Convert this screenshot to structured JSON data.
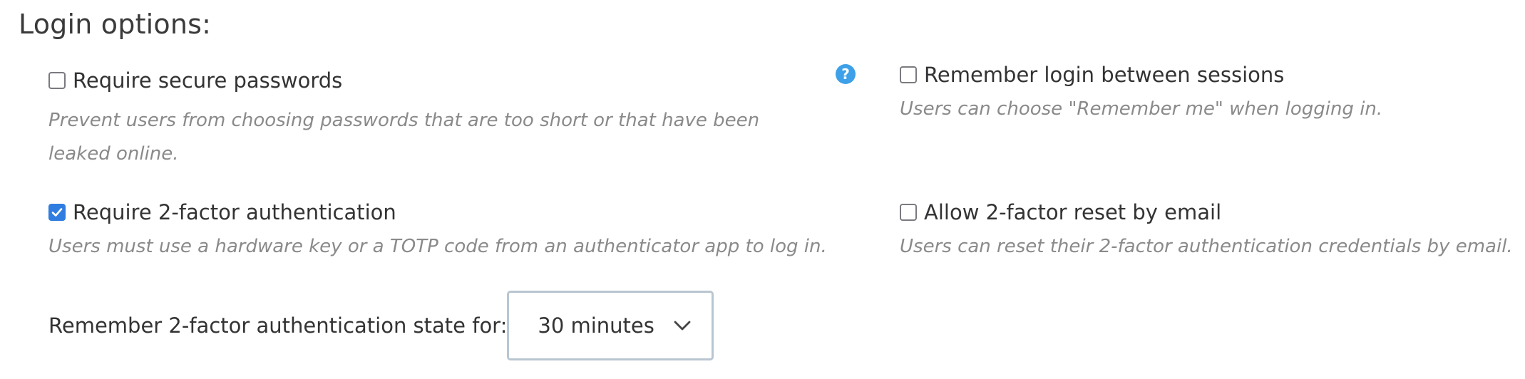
{
  "section": {
    "title": "Login options:"
  },
  "options": {
    "secure_passwords": {
      "label": "Require secure passwords",
      "description": "Prevent users from choosing passwords that are too short or that have been leaked online.",
      "checked": false
    },
    "remember_login": {
      "label": "Remember login between sessions",
      "description": "Users can choose \"Remember me\" when logging in.",
      "checked": false
    },
    "require_2fa": {
      "label": "Require 2-factor authentication",
      "description": "Users must use a hardware key or a TOTP code from an authenticator app to log in.",
      "checked": true
    },
    "allow_2fa_reset": {
      "label": "Allow 2-factor reset by email",
      "description": "Users can reset their 2-factor authentication credentials by email.",
      "checked": false
    }
  },
  "help": {
    "icon": "question-circle-icon",
    "symbol": "?"
  },
  "remember_2fa": {
    "label": "Remember 2-factor authentication state for:",
    "selected": "30 minutes"
  },
  "colors": {
    "accent": "#2f7de0",
    "help": "#3da0e8",
    "muted_text": "#8a8a8a",
    "select_border": "#b9c6d2"
  }
}
